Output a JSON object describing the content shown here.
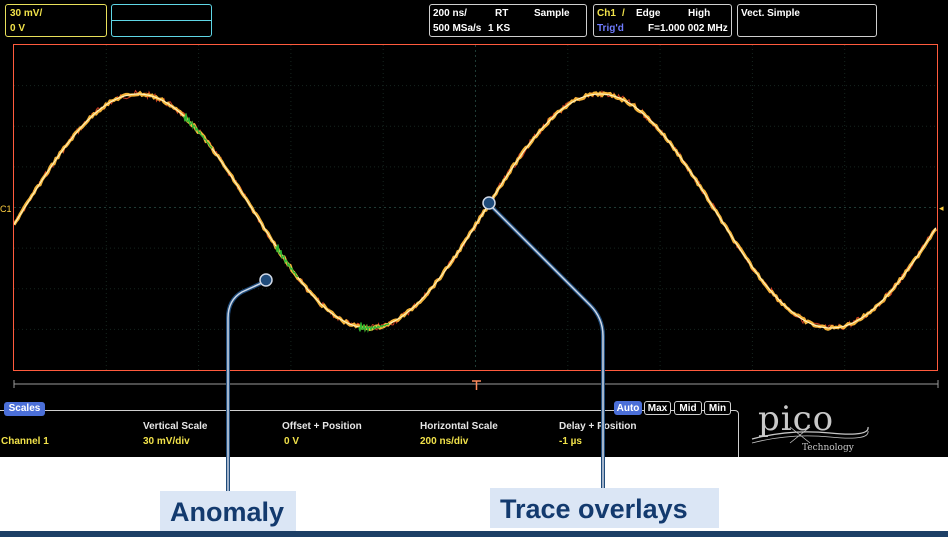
{
  "channel_box": {
    "volts_per_div": "30 mV/",
    "offset": "0 V"
  },
  "timebase_box": {
    "time_per_div": "200 ns/",
    "mode": "RT",
    "acq": "Sample",
    "sample_rate": "500 MSa/s",
    "record_length": "1 KS"
  },
  "trigger_box": {
    "source": "Ch1",
    "slash": "/",
    "type": "Edge",
    "level": "High",
    "status": "Trig'd",
    "frequency": "F=1.000 002 MHz"
  },
  "measure_box": {
    "label": "Vect. Simple"
  },
  "channel_marker": "C1",
  "scales": {
    "tab_label": "Scales",
    "headers": [
      "Vertical Scale",
      "Offset + Position",
      "Horizontal Scale",
      "Delay + Position"
    ],
    "row_label": "Channel 1",
    "values": [
      "30 mV/div",
      "0 V",
      "200 ns/div",
      "-1 µs"
    ]
  },
  "modes": [
    {
      "label": "Auto",
      "active": true
    },
    {
      "label": "Max",
      "active": false
    },
    {
      "label": "Mid",
      "active": false
    },
    {
      "label": "Min",
      "active": false
    }
  ],
  "logo": {
    "word": "pico",
    "sub": "Technology"
  },
  "callouts": {
    "anomaly": "Anomaly",
    "trace_overlays": "Trace overlays"
  },
  "colors": {
    "trace": "#f5b43a",
    "trace_core": "#fff7c8",
    "noise": "#ff4a2a",
    "anomaly": "#2fb52f",
    "border": "#ff5b3d",
    "callout_line": "#1f4b7a"
  }
}
